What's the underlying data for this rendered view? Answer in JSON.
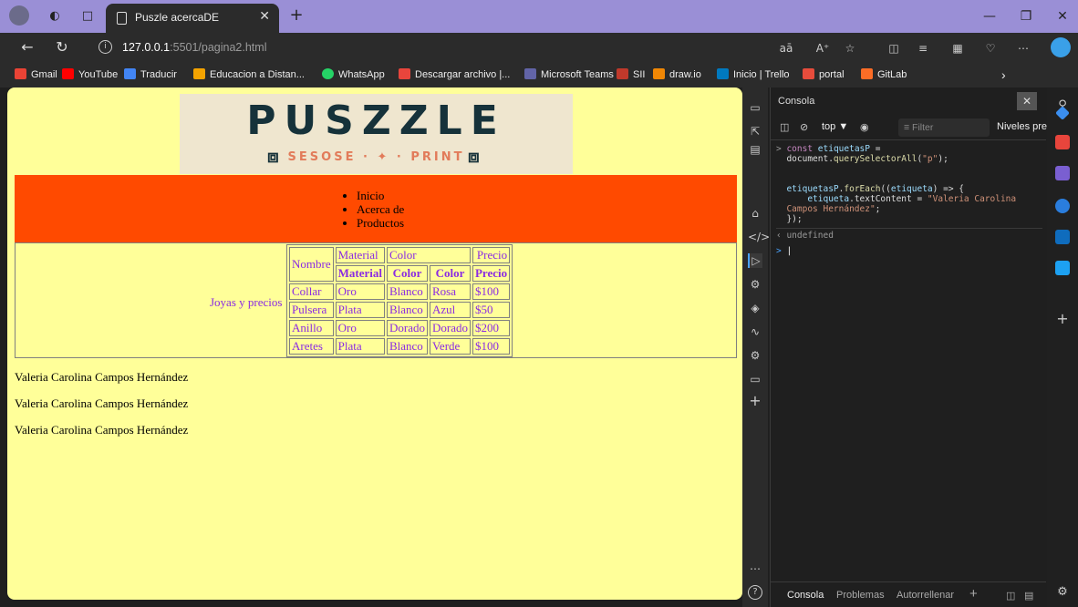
{
  "browser": {
    "tab_title": "Puszle acercaDE",
    "url_host": "127.0.0.1",
    "url_path": ":5501/pagina2.html"
  },
  "favorites": [
    {
      "label": "Gmail",
      "color": "#ea4335"
    },
    {
      "label": "YouTube",
      "color": "#ff0000"
    },
    {
      "label": "Traducir",
      "color": "#4285f4"
    },
    {
      "label": "Educacion a Distan...",
      "color": "#f4a300"
    },
    {
      "label": "WhatsApp",
      "color": "#25d366"
    },
    {
      "label": "Descargar archivo |...",
      "color": "#e8453c"
    },
    {
      "label": "Microsoft Teams",
      "color": "#6264a7"
    },
    {
      "label": "SII",
      "color": "#c0392b"
    },
    {
      "label": "draw.io",
      "color": "#f08705"
    },
    {
      "label": "Inicio | Trello",
      "color": "#0079bf"
    },
    {
      "label": "portal",
      "color": "#e74c3c"
    },
    {
      "label": "GitLab",
      "color": "#fc6d26"
    }
  ],
  "page": {
    "logo_title": "PUSZZLE",
    "logo_subtitle": "SESOSE · ✦ · PRINT",
    "nav_items": [
      "Inicio",
      "Acerca de",
      "Productos"
    ],
    "table_caption": "Joyas y precios",
    "table_header1": {
      "name": "Nombre",
      "material": "Material",
      "color": "Color",
      "price": "Precio"
    },
    "table_header2": [
      "Material",
      "Color",
      "Color",
      "Precio"
    ],
    "table_rows": [
      [
        "Collar",
        "Oro",
        "Blanco",
        "Rosa",
        "$100"
      ],
      [
        "Pulsera",
        "Plata",
        "Blanco",
        "Azul",
        "$50"
      ],
      [
        "Anillo",
        "Oro",
        "Dorado",
        "Dorado",
        "$200"
      ],
      [
        "Aretes",
        "Plata",
        "Blanco",
        "Verde",
        "$100"
      ]
    ],
    "paragraphs": [
      "Valeria Carolina Campos Hernández",
      "Valeria Carolina Campos Hernández",
      "Valeria Carolina Campos Hernández"
    ]
  },
  "devtools": {
    "panel_title": "Consola",
    "context": "top",
    "filter_placeholder": "Filter",
    "levels": "Niveles pre",
    "console_result": "undefined",
    "footer_tabs": [
      "Consola",
      "Problemas",
      "Autorrellenar"
    ]
  }
}
